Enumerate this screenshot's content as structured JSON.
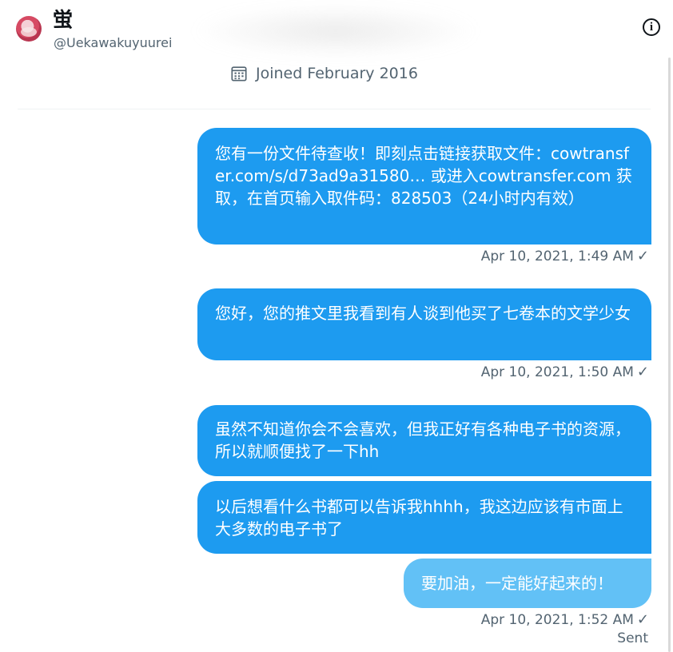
{
  "header": {
    "name": "蛍",
    "handle": "@Uekawakuyuurei",
    "joined": "Joined February 2016",
    "info_icon": "info-icon",
    "calendar_icon": "calendar-icon"
  },
  "messages": [
    {
      "text": "您有一份文件待查收！即刻点击链接获取文件：cowtransfer.com/s/d73ad9a31580… 或进入cowtransfer.com 获取，在首页输入取件码：828503（24小时内有效）",
      "timestamp": "Apr 10, 2021, 1:49 AM",
      "check": "✓"
    },
    {
      "text": "您好，您的推文里我看到有人谈到他买了七卷本的文学少女",
      "timestamp": "Apr 10, 2021, 1:50 AM",
      "check": "✓"
    },
    {
      "text": "虽然不知道你会不会喜欢，但我正好有各种电子书的资源，所以就顺便找了一下hh"
    },
    {
      "text": "以后想看什么书都可以告诉我hhhh，我这边应该有市面上大多数的电子书了"
    },
    {
      "text": "要加油，一定能好起来的！",
      "timestamp": "Apr 10, 2021, 1:52 AM",
      "check": "✓",
      "status": "Sent"
    }
  ],
  "colors": {
    "bubble": "#1d9bf0",
    "bubble_pending": "#62c1f6",
    "secondary_text": "#536471"
  }
}
